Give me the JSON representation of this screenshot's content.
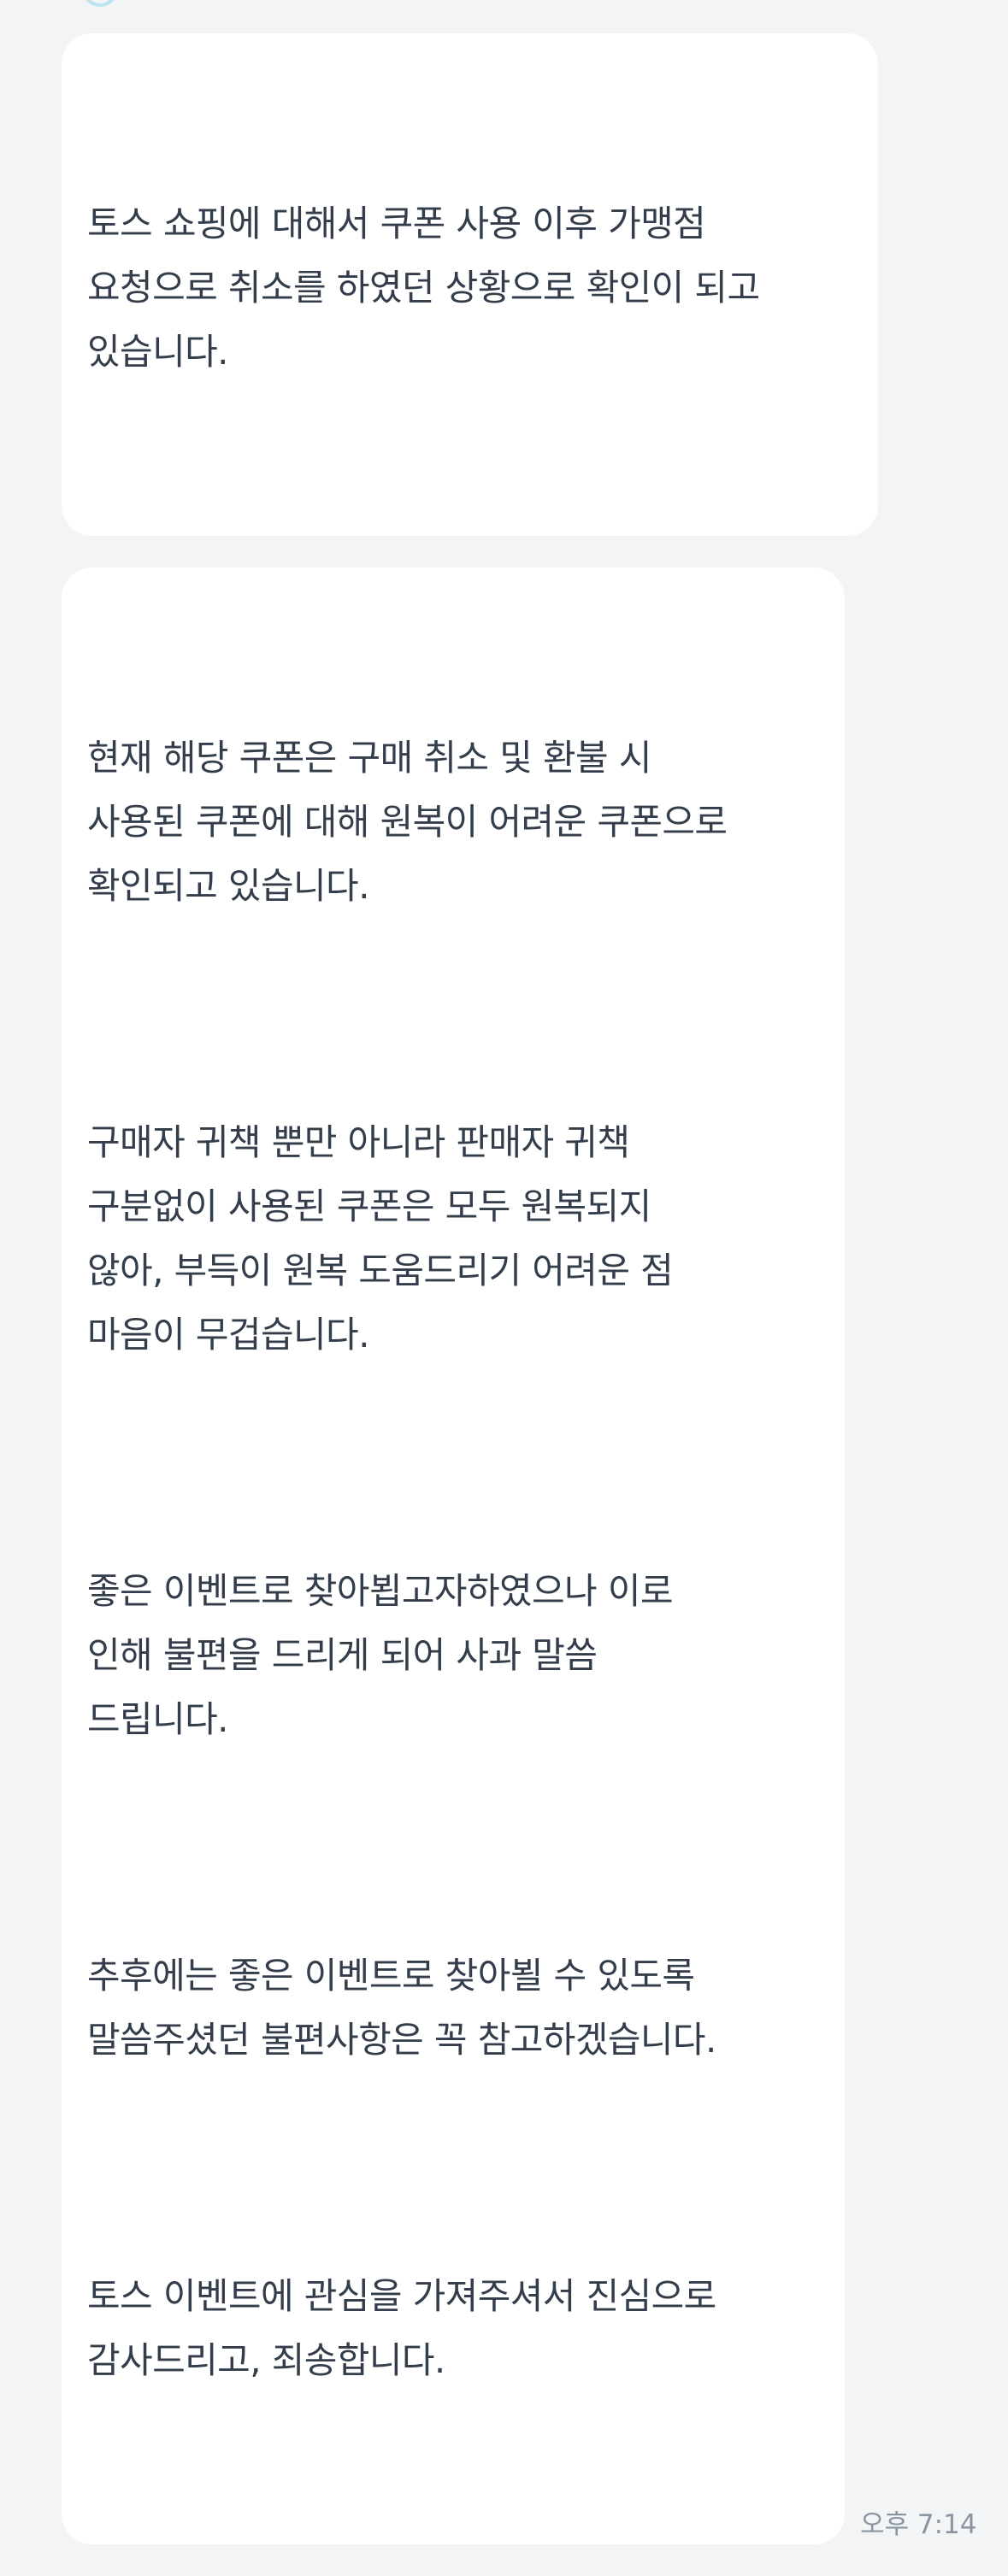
{
  "messages": [
    {
      "paragraphs": [
        "토스 쇼핑에 대해서 쿠폰 사용 이후 가맹점\n요청으로 취소를 하였던 상황으로 확인이 되고\n있습니다."
      ]
    },
    {
      "paragraphs": [
        "현재 해당 쿠폰은 구매 취소 및 환불 시\n사용된 쿠폰에 대해 원복이 어려운 쿠폰으로\n확인되고 있습니다.",
        "구매자 귀책 뿐만 아니라 판매자 귀책\n구분없이 사용된 쿠폰은 모두 원복되지\n않아, 부득이 원복 도움드리기 어려운 점\n마음이 무겁습니다.",
        "좋은 이벤트로 찾아뵙고자하였으나 이로\n인해 불편을 드리게 되어 사과 말씀\n드립니다.",
        "추후에는 좋은 이벤트로 찾아뵐 수 있도록\n말씀주셨던 불편사항은 꼭 참고하겠습니다.",
        "토스 이벤트에 관심을 가져주셔서 진심으로\n감사드리고, 죄송합니다."
      ],
      "timestamp": "오후 7:14"
    }
  ]
}
